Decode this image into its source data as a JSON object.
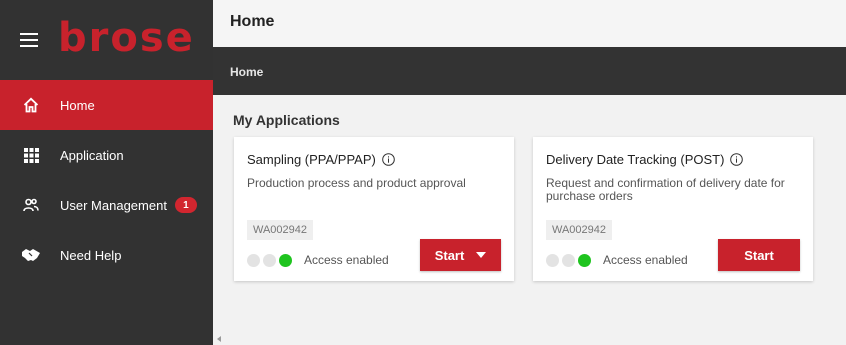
{
  "brand": {
    "logo_text": "brose",
    "hamburger_icon": "hamburger-icon"
  },
  "sidebar": {
    "items": [
      {
        "label": "Home",
        "icon": "home-icon",
        "active": true
      },
      {
        "label": "Application",
        "icon": "grid-icon",
        "active": false
      },
      {
        "label": "User Management",
        "icon": "users-icon",
        "active": false,
        "badge": "1"
      },
      {
        "label": "Need Help",
        "icon": "handshake-icon",
        "active": false
      }
    ]
  },
  "header": {
    "title": "Home"
  },
  "breadcrumb": {
    "current": "Home"
  },
  "main": {
    "section_title": "My Applications",
    "cards": [
      {
        "title": "Sampling (PPA/PPAP)",
        "description": "Production process and product approval",
        "id": "WA002942",
        "status": "Access enabled",
        "button_label": "Start",
        "has_dropdown": true
      },
      {
        "title": "Delivery Date Tracking (POST)",
        "description": "Request and confirmation of delivery date for purchase orders",
        "id": "WA002942",
        "status": "Access enabled",
        "button_label": "Start",
        "has_dropdown": false
      }
    ]
  },
  "colors": {
    "accent": "#c8222c",
    "sidebar": "#323232",
    "status_on": "#1fc41f",
    "status_off": "#e3e3e3"
  }
}
